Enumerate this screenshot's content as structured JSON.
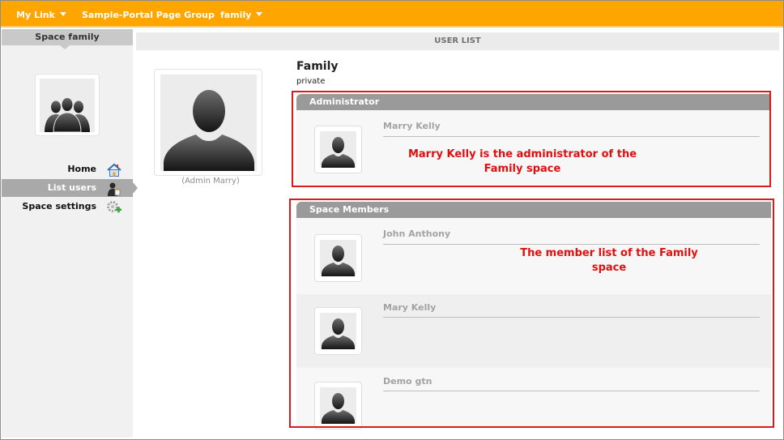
{
  "nav": {
    "my_link": "My Link",
    "page_group": "Sample-Portal Page Group",
    "family": "family"
  },
  "sidebar": {
    "title": "Space family",
    "items": [
      {
        "label": "Home",
        "icon": "home-icon"
      },
      {
        "label": "List users",
        "icon": "user-icon",
        "active": true
      },
      {
        "label": "Space settings",
        "icon": "settings-add-icon"
      }
    ]
  },
  "user_list": {
    "header": "USER LIST",
    "admin_caption": "(Admin Marry)",
    "space_name": "Family",
    "space_privacy": "private",
    "administrator": {
      "title": "Administrator",
      "members": [
        {
          "name": "Marry Kelly"
        }
      ]
    },
    "space_members": {
      "title": "Space Members",
      "members": [
        {
          "name": "John Anthony"
        },
        {
          "name": "Mary Kelly"
        },
        {
          "name": "Demo gtn"
        }
      ]
    }
  },
  "annotations": {
    "admin_note_line1": "Marry Kelly is the administrator of the",
    "admin_note_line2": "Family space",
    "members_note_line1": "The member list of the Family",
    "members_note_line2": "space"
  },
  "colors": {
    "topbar": "#ffa500",
    "annotation": "#e10f0f",
    "section_bar": "#9a9a9a"
  }
}
